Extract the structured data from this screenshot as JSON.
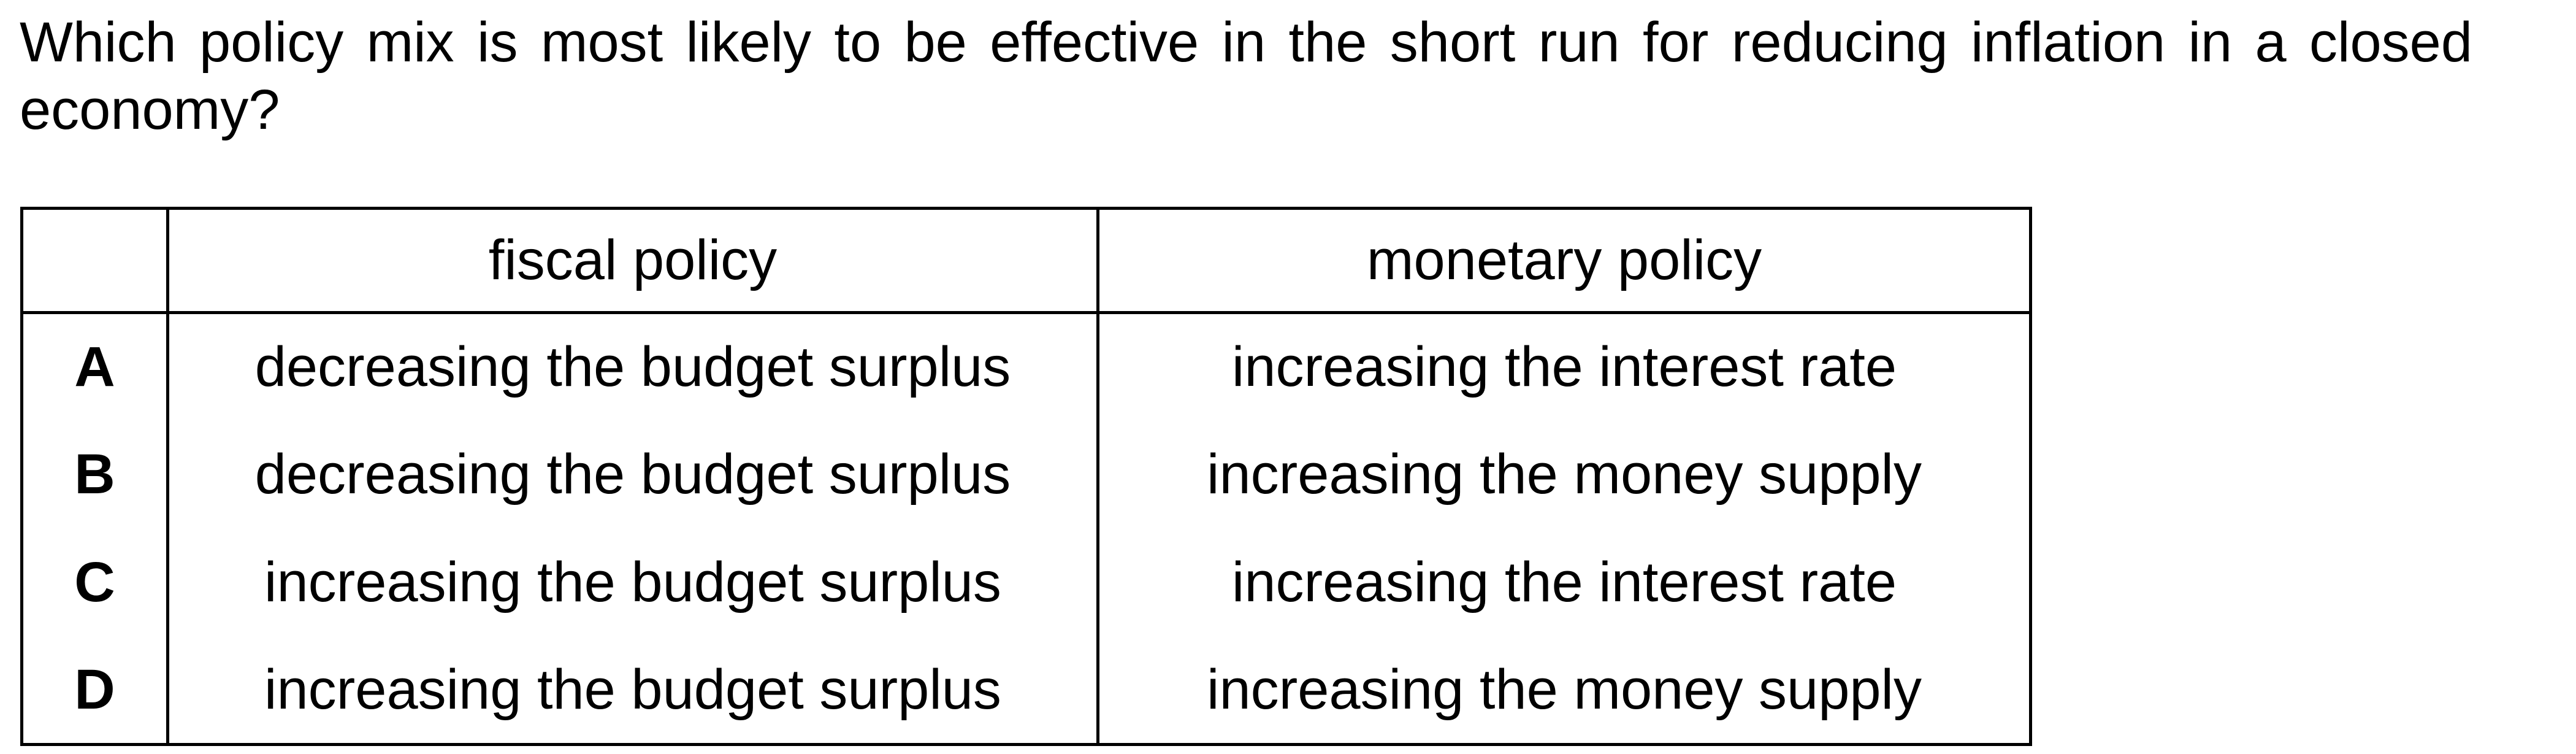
{
  "question": {
    "text": "Which policy mix is most likely to be effective in the short run for reducing inflation in a closed economy?"
  },
  "table": {
    "headers": [
      "",
      "fiscal policy",
      "monetary policy"
    ],
    "rows": [
      {
        "letter": "A",
        "fiscal": "decreasing the budget surplus",
        "monetary": "increasing the interest rate"
      },
      {
        "letter": "B",
        "fiscal": "decreasing the budget surplus",
        "monetary": "increasing the money supply"
      },
      {
        "letter": "C",
        "fiscal": "increasing the budget surplus",
        "monetary": "increasing the interest rate"
      },
      {
        "letter": "D",
        "fiscal": "increasing the budget surplus",
        "monetary": "increasing the money supply"
      }
    ]
  }
}
